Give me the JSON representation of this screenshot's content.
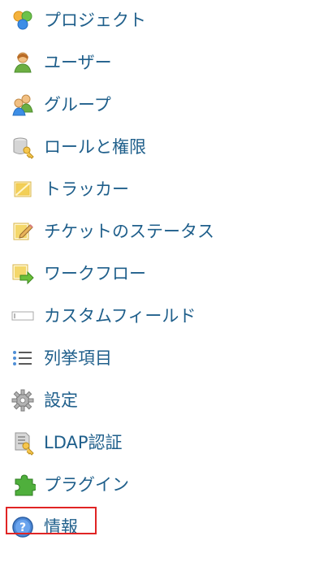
{
  "admin_menu": {
    "items": [
      {
        "label": "プロジェクト",
        "icon": "projects-icon"
      },
      {
        "label": "ユーザー",
        "icon": "user-icon"
      },
      {
        "label": "グループ",
        "icon": "group-icon"
      },
      {
        "label": "ロールと権限",
        "icon": "database-key-icon"
      },
      {
        "label": "トラッカー",
        "icon": "tracker-icon"
      },
      {
        "label": "チケットのステータス",
        "icon": "edit-note-icon"
      },
      {
        "label": "ワークフロー",
        "icon": "workflow-icon"
      },
      {
        "label": "カスタムフィールド",
        "icon": "textfield-icon"
      },
      {
        "label": "列挙項目",
        "icon": "list-icon"
      },
      {
        "label": "設定",
        "icon": "gear-icon"
      },
      {
        "label": "LDAP認証",
        "icon": "ldap-server-key-icon"
      },
      {
        "label": "プラグイン",
        "icon": "plugin-icon"
      },
      {
        "label": "情報",
        "icon": "help-icon"
      }
    ],
    "selected_index": 12,
    "colors": {
      "link": "#1f5f8b",
      "highlight": "#e02424"
    }
  }
}
